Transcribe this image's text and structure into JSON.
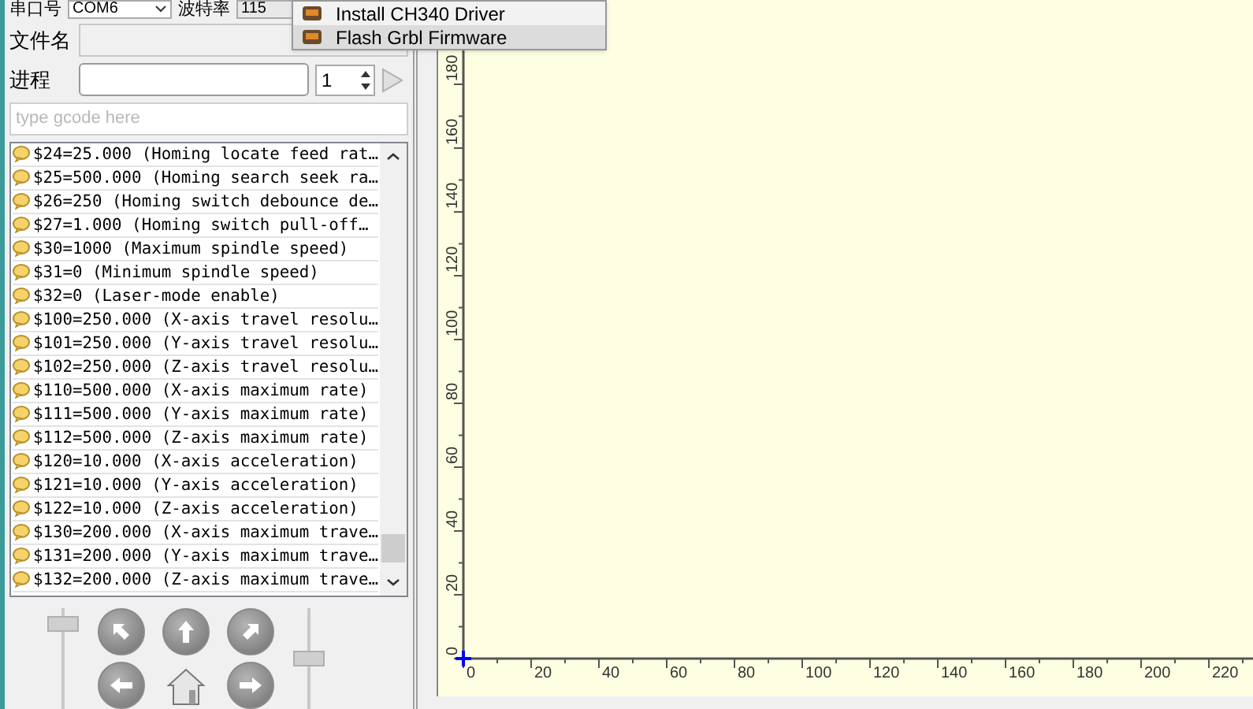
{
  "connection": {
    "port_label": "串口号",
    "port_value": "COM6",
    "baud_label": "波特率",
    "baud_value": "115"
  },
  "file": {
    "label": "文件名"
  },
  "progress": {
    "label": "进程",
    "level": 0,
    "copies": "1",
    "run_disabled": true
  },
  "gcode_input": {
    "placeholder": "type gcode here"
  },
  "log": [
    {
      "text": "$24=25.000 (Homing locate feed rat…"
    },
    {
      "text": "$25=500.000 (Homing search seek ra…"
    },
    {
      "text": "$26=250 (Homing switch debounce de…"
    },
    {
      "text": "$27=1.000 (Homing switch pull-off…"
    },
    {
      "text": "$30=1000 (Maximum spindle speed)"
    },
    {
      "text": "$31=0 (Minimum spindle speed)"
    },
    {
      "text": "$32=0 (Laser-mode enable)"
    },
    {
      "text": "$100=250.000 (X-axis travel resolu…"
    },
    {
      "text": "$101=250.000 (Y-axis travel resolu…"
    },
    {
      "text": "$102=250.000 (Z-axis travel resolu…"
    },
    {
      "text": "$110=500.000 (X-axis maximum rate)"
    },
    {
      "text": "$111=500.000 (Y-axis maximum rate)"
    },
    {
      "text": "$112=500.000 (Z-axis maximum rate)"
    },
    {
      "text": "$120=10.000 (X-axis acceleration)"
    },
    {
      "text": "$121=10.000 (Y-axis acceleration)"
    },
    {
      "text": "$122=10.000 (Z-axis acceleration)"
    },
    {
      "text": "$130=200.000 (X-axis maximum trave…"
    },
    {
      "text": "$131=200.000 (Y-axis maximum trave…"
    },
    {
      "text": "$132=200.000 (Z-axis maximum trave…"
    }
  ],
  "jog": {
    "speed_slider": {
      "level": 0.9
    },
    "step_slider": {
      "level": 0.5
    }
  },
  "menu": [
    {
      "label": "Install CH340 Driver",
      "selected": false
    },
    {
      "label": "Flash Grbl Firmware",
      "selected": true
    }
  ],
  "canvas": {
    "y_ruler": [
      "0",
      "20",
      "40",
      "60",
      "80",
      "100",
      "120",
      "140",
      "160",
      "180"
    ],
    "x_ruler": [
      "0",
      "20",
      "40",
      "60",
      "80",
      "100",
      "120",
      "140",
      "160",
      "180",
      "200",
      "220"
    ]
  }
}
